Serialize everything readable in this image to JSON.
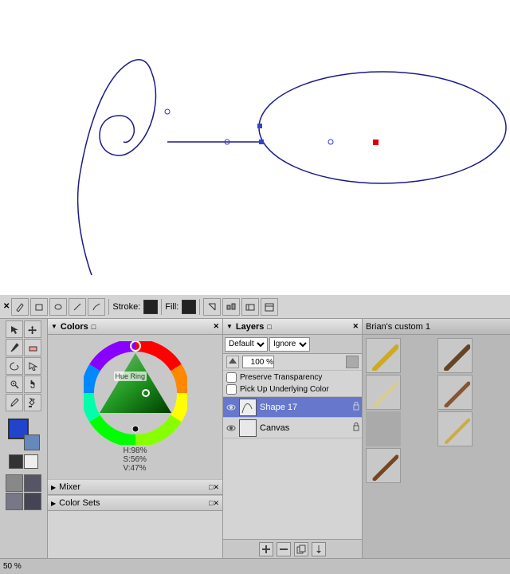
{
  "canvas": {
    "background": "white"
  },
  "toolbar": {
    "stroke_label": "Stroke:",
    "fill_label": "Fill:",
    "stroke_color": "#222",
    "fill_color": "#222"
  },
  "colors_panel": {
    "title": "Colors",
    "hue_label": "Hue Ring",
    "h_value": "H:98%",
    "s_value": "S:56%",
    "v_value": "V:47%",
    "mixer_label": "Mixer",
    "color_sets_label": "Color Sets"
  },
  "layers_panel": {
    "title": "Layers",
    "blend_mode": "Default",
    "blend_mode2": "Ignore",
    "opacity": "100%",
    "preserve_transparency": "Preserve Transparency",
    "pick_up_color": "Pick Up Underlying Color",
    "layers": [
      {
        "name": "Shape 17",
        "visible": true,
        "type": "shape",
        "active": true
      },
      {
        "name": "Canvas",
        "visible": true,
        "type": "canvas",
        "active": false
      }
    ]
  },
  "custom_panel": {
    "title": "Brian's custom 1"
  },
  "status_bar": {
    "zoom": "50 %"
  }
}
